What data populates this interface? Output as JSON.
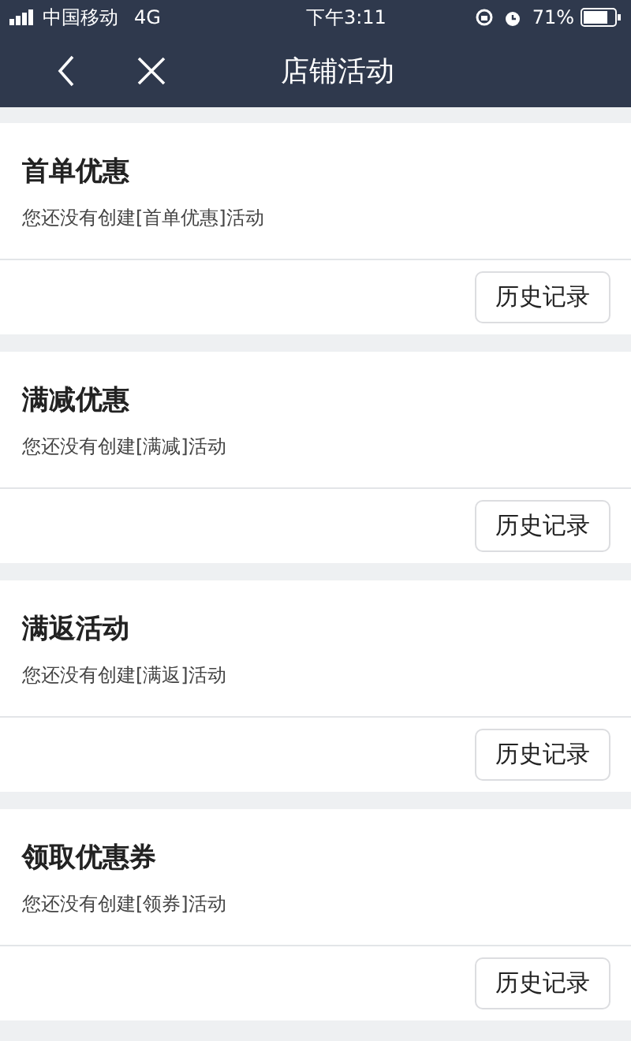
{
  "status_bar": {
    "carrier": "中国移动",
    "network": "4G",
    "time": "下午3:11",
    "battery": "71%"
  },
  "nav": {
    "title": "店铺活动"
  },
  "sections": [
    {
      "title": "首单优惠",
      "description": "您还没有创建[首单优惠]活动",
      "button": "历史记录"
    },
    {
      "title": "满减优惠",
      "description": "您还没有创建[满减]活动",
      "button": "历史记录"
    },
    {
      "title": "满返活动",
      "description": "您还没有创建[满返]活动",
      "button": "历史记录"
    },
    {
      "title": "领取优惠券",
      "description": "您还没有创建[领券]活动",
      "button": "历史记录"
    }
  ]
}
